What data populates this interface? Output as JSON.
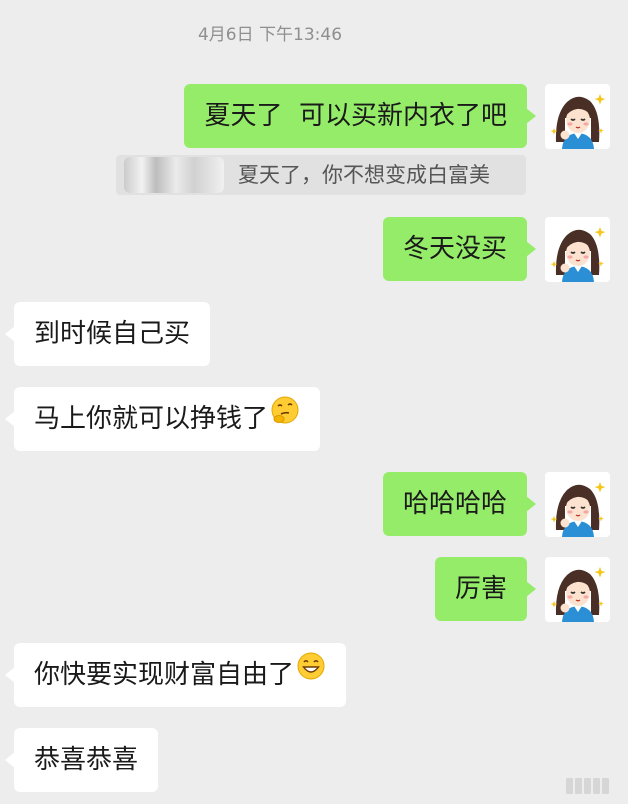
{
  "chat": {
    "timestamp": "4月6日  下午13:46",
    "messages": [
      {
        "side": "out",
        "text": "夏天了  可以买新内衣了吧"
      },
      {
        "side": "quote",
        "text": "夏天了，你不想变成白富美"
      },
      {
        "side": "out",
        "text": "冬天没买"
      },
      {
        "side": "in",
        "text": "到时候自己买"
      },
      {
        "side": "in",
        "text": "马上你就可以挣钱了",
        "emoji": "thinking-face-emoji"
      },
      {
        "side": "out",
        "text": "哈哈哈哈"
      },
      {
        "side": "out",
        "text": "厉害"
      },
      {
        "side": "in",
        "text": "你快要实现财富自由了",
        "emoji": "grinning-face-emoji"
      },
      {
        "side": "in",
        "text": "恭喜恭喜"
      }
    ]
  },
  "colors": {
    "background": "#ededed",
    "outgoing_bubble": "#95ec69",
    "incoming_bubble": "#ffffff",
    "quote_background": "#e1e1e1"
  },
  "icons": {
    "avatar": "cartoon-girl-avatar",
    "emoji_1": "thinking-face-emoji",
    "emoji_2": "grinning-face-emoji"
  }
}
